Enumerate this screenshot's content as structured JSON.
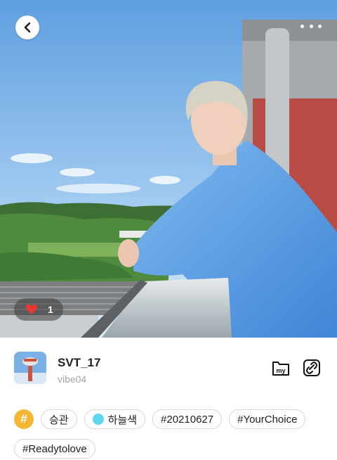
{
  "photo": {
    "like_count": "1"
  },
  "profile": {
    "username": "SVT_17",
    "user_id": "vibe04"
  },
  "actions": {
    "my_label": "my"
  },
  "tags": {
    "hash_symbol": "#",
    "items": [
      "승관",
      "하늘색",
      "#20210627",
      "#YourChoice",
      "#Readytolove"
    ]
  },
  "colors": {
    "accent_hash": "#f4b733",
    "sky_dot": "#5ed6ee",
    "like_heart": "#e53935"
  }
}
